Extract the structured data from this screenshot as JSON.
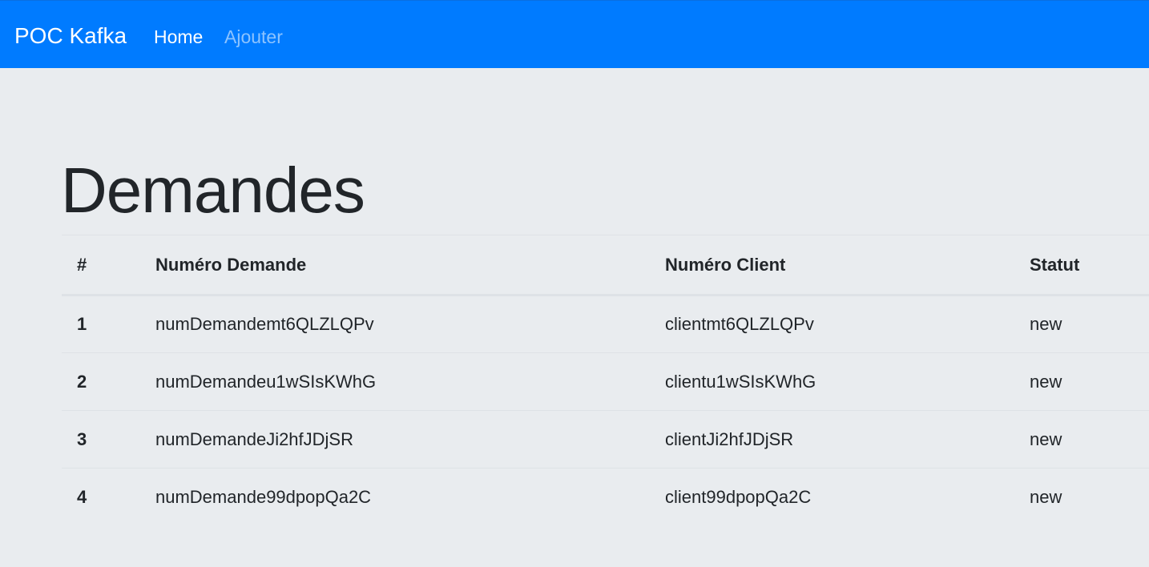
{
  "navbar": {
    "brand": "POC Kafka",
    "links": [
      {
        "label": "Home",
        "active": true
      },
      {
        "label": "Ajouter",
        "active": false
      }
    ],
    "color": "#007bff"
  },
  "page": {
    "title": "Demandes",
    "background": "#e9ecef"
  },
  "table": {
    "headers": [
      "#",
      "Numéro Demande",
      "Numéro Client",
      "Statut"
    ],
    "rows": [
      {
        "index": "1",
        "numero_demande": "numDemandemt6QLZLQPv",
        "numero_client": "clientmt6QLZLQPv",
        "statut": "new"
      },
      {
        "index": "2",
        "numero_demande": "numDemandeu1wSIsKWhG",
        "numero_client": "clientu1wSIsKWhG",
        "statut": "new"
      },
      {
        "index": "3",
        "numero_demande": "numDemandeJi2hfJDjSR",
        "numero_client": "clientJi2hfJDjSR",
        "statut": "new"
      },
      {
        "index": "4",
        "numero_demande": "numDemande99dpopQa2C",
        "numero_client": "client99dpopQa2C",
        "statut": "new"
      }
    ]
  }
}
